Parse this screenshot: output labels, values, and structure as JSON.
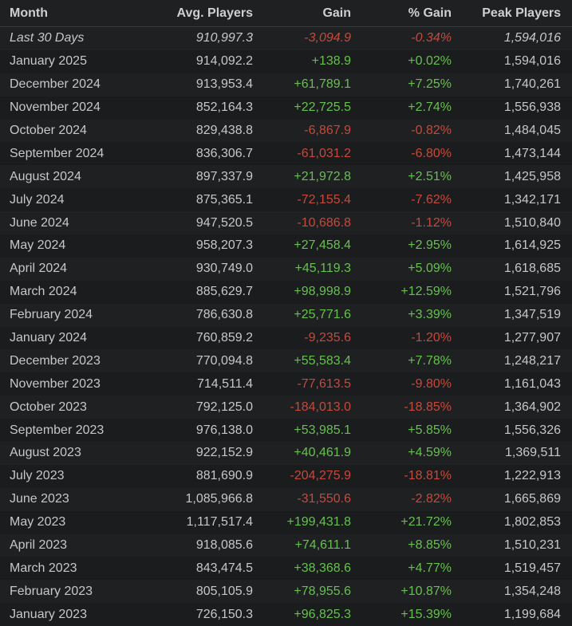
{
  "headers": {
    "month": "Month",
    "avg": "Avg. Players",
    "gain": "Gain",
    "pct": "% Gain",
    "peak": "Peak Players"
  },
  "rows": [
    {
      "month": "Last 30 Days",
      "avg": "910,997.3",
      "gain": "-3,094.9",
      "pct": "-0.34%",
      "peak": "1,594,016",
      "sign": "neg",
      "italic": true
    },
    {
      "month": "January 2025",
      "avg": "914,092.2",
      "gain": "+138.9",
      "pct": "+0.02%",
      "peak": "1,594,016",
      "sign": "pos"
    },
    {
      "month": "December 2024",
      "avg": "913,953.4",
      "gain": "+61,789.1",
      "pct": "+7.25%",
      "peak": "1,740,261",
      "sign": "pos"
    },
    {
      "month": "November 2024",
      "avg": "852,164.3",
      "gain": "+22,725.5",
      "pct": "+2.74%",
      "peak": "1,556,938",
      "sign": "pos"
    },
    {
      "month": "October 2024",
      "avg": "829,438.8",
      "gain": "-6,867.9",
      "pct": "-0.82%",
      "peak": "1,484,045",
      "sign": "neg"
    },
    {
      "month": "September 2024",
      "avg": "836,306.7",
      "gain": "-61,031.2",
      "pct": "-6.80%",
      "peak": "1,473,144",
      "sign": "neg"
    },
    {
      "month": "August 2024",
      "avg": "897,337.9",
      "gain": "+21,972.8",
      "pct": "+2.51%",
      "peak": "1,425,958",
      "sign": "pos"
    },
    {
      "month": "July 2024",
      "avg": "875,365.1",
      "gain": "-72,155.4",
      "pct": "-7.62%",
      "peak": "1,342,171",
      "sign": "neg"
    },
    {
      "month": "June 2024",
      "avg": "947,520.5",
      "gain": "-10,686.8",
      "pct": "-1.12%",
      "peak": "1,510,840",
      "sign": "neg"
    },
    {
      "month": "May 2024",
      "avg": "958,207.3",
      "gain": "+27,458.4",
      "pct": "+2.95%",
      "peak": "1,614,925",
      "sign": "pos"
    },
    {
      "month": "April 2024",
      "avg": "930,749.0",
      "gain": "+45,119.3",
      "pct": "+5.09%",
      "peak": "1,618,685",
      "sign": "pos"
    },
    {
      "month": "March 2024",
      "avg": "885,629.7",
      "gain": "+98,998.9",
      "pct": "+12.59%",
      "peak": "1,521,796",
      "sign": "pos"
    },
    {
      "month": "February 2024",
      "avg": "786,630.8",
      "gain": "+25,771.6",
      "pct": "+3.39%",
      "peak": "1,347,519",
      "sign": "pos"
    },
    {
      "month": "January 2024",
      "avg": "760,859.2",
      "gain": "-9,235.6",
      "pct": "-1.20%",
      "peak": "1,277,907",
      "sign": "neg"
    },
    {
      "month": "December 2023",
      "avg": "770,094.8",
      "gain": "+55,583.4",
      "pct": "+7.78%",
      "peak": "1,248,217",
      "sign": "pos"
    },
    {
      "month": "November 2023",
      "avg": "714,511.4",
      "gain": "-77,613.5",
      "pct": "-9.80%",
      "peak": "1,161,043",
      "sign": "neg"
    },
    {
      "month": "October 2023",
      "avg": "792,125.0",
      "gain": "-184,013.0",
      "pct": "-18.85%",
      "peak": "1,364,902",
      "sign": "neg"
    },
    {
      "month": "September 2023",
      "avg": "976,138.0",
      "gain": "+53,985.1",
      "pct": "+5.85%",
      "peak": "1,556,326",
      "sign": "pos"
    },
    {
      "month": "August 2023",
      "avg": "922,152.9",
      "gain": "+40,461.9",
      "pct": "+4.59%",
      "peak": "1,369,511",
      "sign": "pos"
    },
    {
      "month": "July 2023",
      "avg": "881,690.9",
      "gain": "-204,275.9",
      "pct": "-18.81%",
      "peak": "1,222,913",
      "sign": "neg"
    },
    {
      "month": "June 2023",
      "avg": "1,085,966.8",
      "gain": "-31,550.6",
      "pct": "-2.82%",
      "peak": "1,665,869",
      "sign": "neg"
    },
    {
      "month": "May 2023",
      "avg": "1,117,517.4",
      "gain": "+199,431.8",
      "pct": "+21.72%",
      "peak": "1,802,853",
      "sign": "pos"
    },
    {
      "month": "April 2023",
      "avg": "918,085.6",
      "gain": "+74,611.1",
      "pct": "+8.85%",
      "peak": "1,510,231",
      "sign": "pos"
    },
    {
      "month": "March 2023",
      "avg": "843,474.5",
      "gain": "+38,368.6",
      "pct": "+4.77%",
      "peak": "1,519,457",
      "sign": "pos"
    },
    {
      "month": "February 2023",
      "avg": "805,105.9",
      "gain": "+78,955.6",
      "pct": "+10.87%",
      "peak": "1,354,248",
      "sign": "pos"
    },
    {
      "month": "January 2023",
      "avg": "726,150.3",
      "gain": "+96,825.3",
      "pct": "+15.39%",
      "peak": "1,199,684",
      "sign": "pos"
    }
  ],
  "colors": {
    "positive": "#66c04f",
    "negative": "#c6493b",
    "text": "#c7c7c7",
    "background": "#1b1c1e"
  }
}
